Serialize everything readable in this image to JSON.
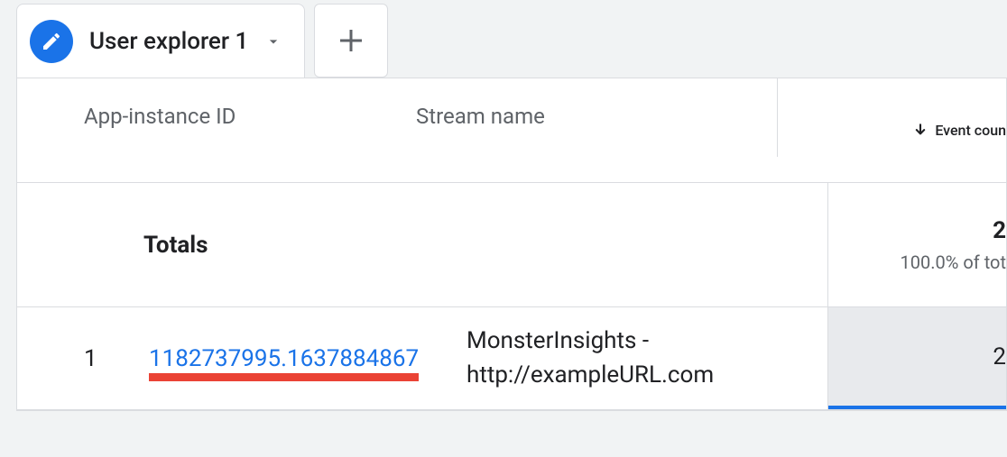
{
  "tab": {
    "title": "User explorer 1"
  },
  "table": {
    "headers": {
      "id": "App-instance ID",
      "stream": "Stream name",
      "event": "Event coun"
    },
    "totals": {
      "label": "Totals",
      "value": "2",
      "percent": "100.0% of tot"
    },
    "rows": [
      {
        "index": "1",
        "id": "1182737995.1637884867",
        "stream": "MonsterInsights - http://exampleURL.com",
        "event": "2"
      }
    ]
  }
}
